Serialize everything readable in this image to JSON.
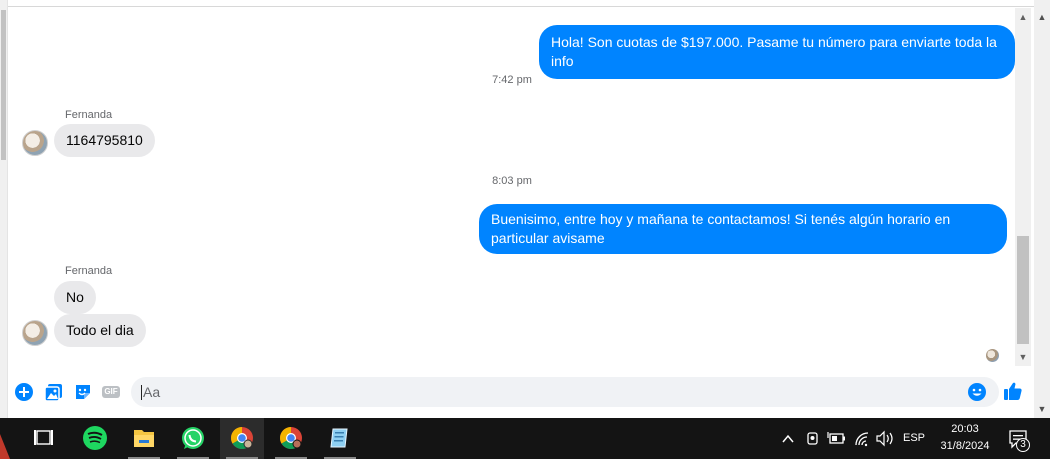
{
  "messages": {
    "outgoing_1": "Hola! Son cuotas de $197.000. Pasame tu número para enviarte toda la info",
    "time_1": "7:42 pm",
    "sender_1": "Fernanda",
    "incoming_1": "1164795810",
    "time_2": "8:03 pm",
    "outgoing_2": "Buenisimo, entre hoy y mañana te contactamos! Si tenés algún horario en particular avisame",
    "sender_2": "Fernanda",
    "incoming_2": "No",
    "incoming_3": "Todo el dia"
  },
  "composer": {
    "placeholder": "Aa",
    "icons": [
      "add-icon",
      "photo-icon",
      "sticker-icon",
      "gif-icon",
      "emoji-icon",
      "like-icon"
    ],
    "gif_label": "GIF"
  },
  "taskbar": {
    "apps": [
      "task-view-icon",
      "spotify-icon",
      "file-explorer-icon",
      "whatsapp-icon",
      "chrome-icon",
      "chrome-profile-icon",
      "notepad-icon"
    ],
    "language": "ESP",
    "time": "20:03",
    "date": "31/8/2024",
    "notification_count": "3"
  },
  "colors": {
    "messenger_blue": "#0084ff",
    "incoming_bubble": "#e9e9eb",
    "taskbar": "#141414"
  }
}
